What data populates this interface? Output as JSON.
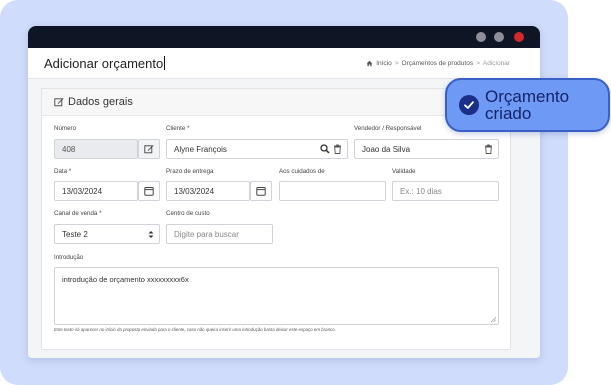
{
  "window": {
    "title": "Adicionar orçamento"
  },
  "breadcrumb": {
    "home": "Início",
    "sep1": ">",
    "section": "Orçamentos de produtos",
    "sep2": ">",
    "current": "Adicionar"
  },
  "panel": {
    "title": "Dados gerais"
  },
  "form": {
    "numero": {
      "label": "Número",
      "value": "408"
    },
    "cliente": {
      "label": "Cliente *",
      "value": "Alyne François"
    },
    "vendedor": {
      "label": "Vendedor / Responsável",
      "value": "Joao da Silva"
    },
    "data": {
      "label": "Data *",
      "value": "13/03/2024"
    },
    "prazo": {
      "label": "Prazo de entrega",
      "value": "13/03/2024"
    },
    "cuidados": {
      "label": "Aos cuidados de",
      "value": ""
    },
    "validade": {
      "label": "Validade",
      "placeholder": "Ex.: 10 dias"
    },
    "canal": {
      "label": "Canal de venda *",
      "value": "Teste 2"
    },
    "centro": {
      "label": "Centro de custo",
      "placeholder": "Digite para buscar"
    },
    "introducao": {
      "label": "Introdução",
      "value": "introdução de orçamento xxxxxxxxx6x"
    },
    "help": "Este texto irá aparecer no início da proposta enviada para o cliente, caso não queira inserir uma introdução basta deixar este espaço em branco."
  },
  "toast": {
    "text": "Orçamento criado",
    "icon": "check-circle-icon"
  },
  "colors": {
    "titlebar": "#0e1524",
    "toast_bg": "#6e99f4",
    "toast_border": "#3a5fc6",
    "close_dot": "#d02a2a",
    "background": "#cfdcfb"
  }
}
